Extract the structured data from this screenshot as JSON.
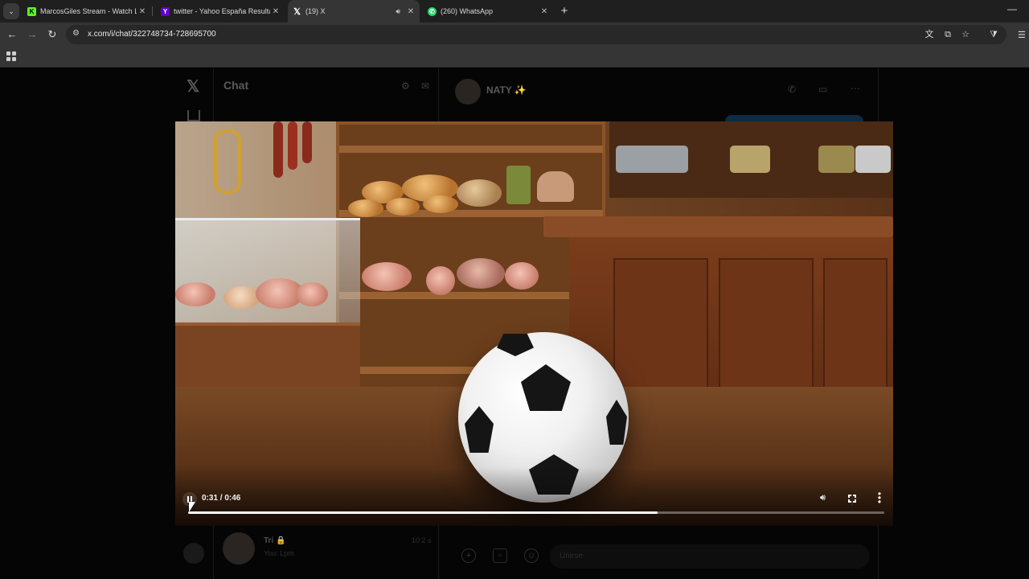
{
  "browser": {
    "tabs": [
      {
        "title": "MarcosGiles Stream - Watch Li...",
        "favicon": "kick-logo-icon",
        "color": "#53fc18",
        "active": false
      },
      {
        "title": "twitter - Yahoo España Resultad",
        "favicon": "yahoo-logo-icon",
        "color": "#6001d2",
        "active": false
      },
      {
        "title": "(19) X",
        "favicon": "x-logo-icon",
        "color": "#ffffff",
        "active": true,
        "audio": true
      },
      {
        "title": "(260) WhatsApp",
        "favicon": "whatsapp-logo-icon",
        "color": "#25d366",
        "active": false
      }
    ],
    "url": "x.com/i/chat/322748734-728695700"
  },
  "page": {
    "section_title": "Chat",
    "conversation_name": "NATY ✨",
    "conversation_sub": "",
    "list_item_name": "Tri 🔒",
    "list_item_sub": "You: Lpm",
    "list_item_time": "10:2 s",
    "composer_placeholder": "Unirse"
  },
  "video": {
    "current_time": "0:31",
    "duration": "0:46",
    "time_label": "0:31 / 0:46",
    "progress_fraction": 0.674,
    "state": "playing"
  }
}
